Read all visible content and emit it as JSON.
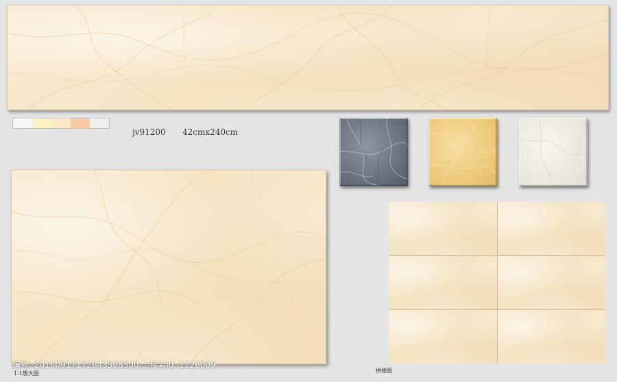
{
  "product": {
    "code": "jv91200",
    "size": "42cmx240cm"
  },
  "swatches": {
    "colors": [
      "#f7f7f5",
      "#fdf3c2",
      "#fce7c6",
      "#fbc9a6",
      "#efefef"
    ]
  },
  "tiles": [
    {
      "name": "gray",
      "color": "#6b7280"
    },
    {
      "name": "gold",
      "color": "#ecc676"
    },
    {
      "name": "white",
      "color": "#ebe8df"
    }
  ],
  "captions": {
    "large_view": "1:1放大图",
    "layout_view": "拼接图"
  },
  "watermark": {
    "text": "编号: 20160917172643568500 上传者id: 1126069"
  }
}
